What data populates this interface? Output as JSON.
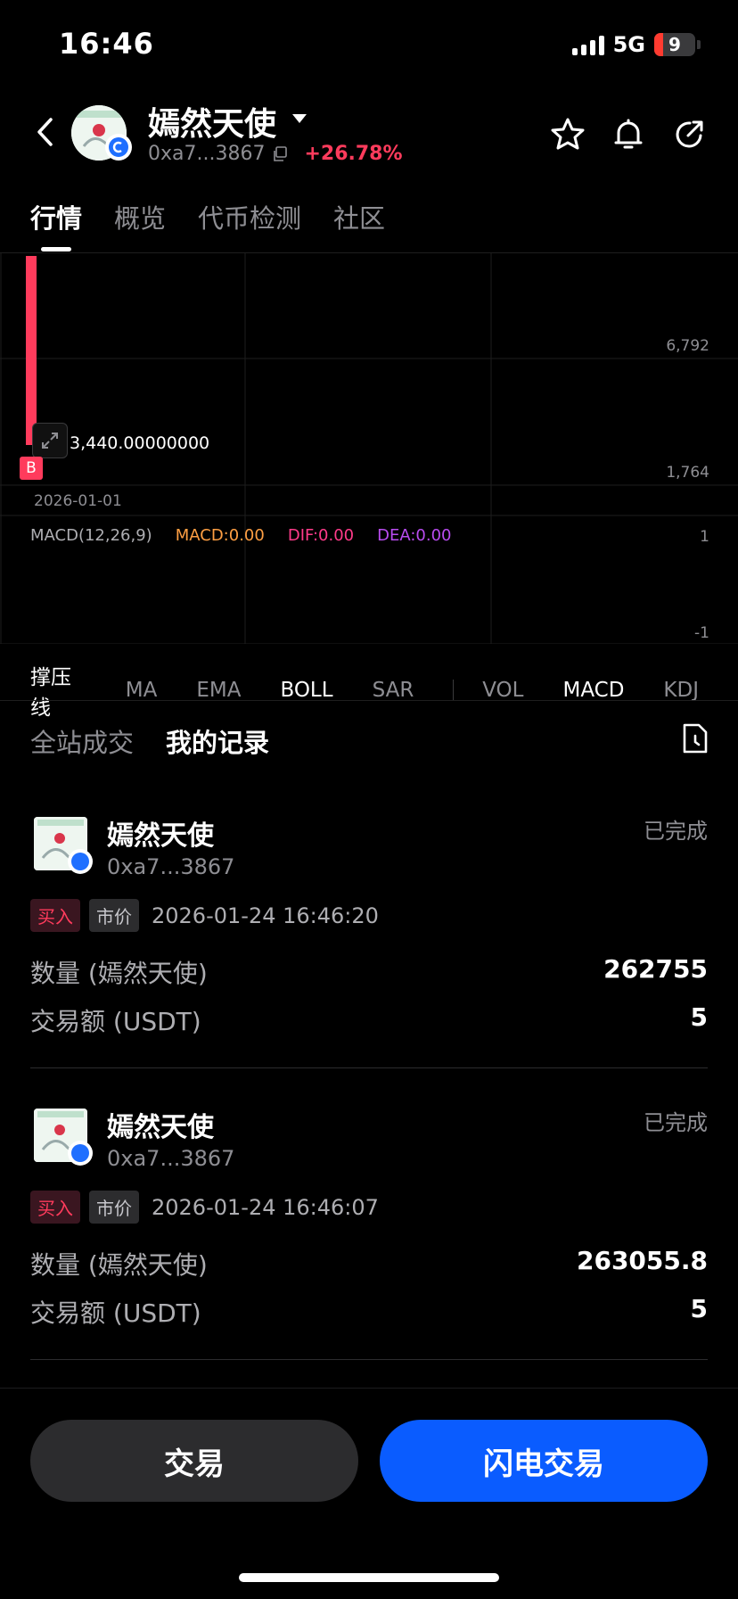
{
  "status_bar": {
    "time": "16:46",
    "network": "5G",
    "battery": "9"
  },
  "header": {
    "token_name": "嫣然天使",
    "address": "0xa7...3867",
    "change": "+26.78%",
    "icons": [
      "back-icon",
      "star-icon",
      "bell-icon",
      "share-icon"
    ]
  },
  "tabs": [
    "行情",
    "概览",
    "代币检测",
    "社区"
  ],
  "chart": {
    "price_label": "3,440.00000000",
    "axis_high": "6,792",
    "axis_low": "1,764",
    "date_label": "2026-01-01",
    "marker": "B",
    "macd": {
      "name": "MACD(12,26,9)",
      "macd": "MACD:0.00",
      "dif": "DIF:0.00",
      "dea": "DEA:0.00",
      "axis_top": "1",
      "axis_bottom": "-1"
    },
    "colors": {
      "candle": "#ff3b5c",
      "macd": "#ff9f43",
      "dif": "#ff3b8a",
      "dea": "#b94cf0"
    }
  },
  "indicators": {
    "main": [
      {
        "label": "撑压线",
        "active": true
      },
      {
        "label": "MA",
        "active": false
      },
      {
        "label": "EMA",
        "active": false
      },
      {
        "label": "BOLL",
        "active": true
      },
      {
        "label": "SAR",
        "active": false
      }
    ],
    "sub": [
      {
        "label": "VOL",
        "active": false
      },
      {
        "label": "MACD",
        "active": true
      },
      {
        "label": "KDJ",
        "active": false
      }
    ]
  },
  "records_tabs": {
    "all": "全站成交",
    "mine": "我的记录"
  },
  "records": [
    {
      "name": "嫣然天使",
      "address": "0xa7...3867",
      "status": "已完成",
      "side": "买入",
      "type": "市价",
      "time": "2026-01-24 16:46:20",
      "qty_label": "数量 (嫣然天使)",
      "qty": "262755",
      "amount_label": "交易额 (USDT)",
      "amount": "5"
    },
    {
      "name": "嫣然天使",
      "address": "0xa7...3867",
      "status": "已完成",
      "side": "买入",
      "type": "市价",
      "time": "2026-01-24 16:46:07",
      "qty_label": "数量 (嫣然天使)",
      "qty": "263055.8",
      "amount_label": "交易额 (USDT)",
      "amount": "5"
    }
  ],
  "buttons": {
    "trade": "交易",
    "flash_trade": "闪电交易"
  }
}
